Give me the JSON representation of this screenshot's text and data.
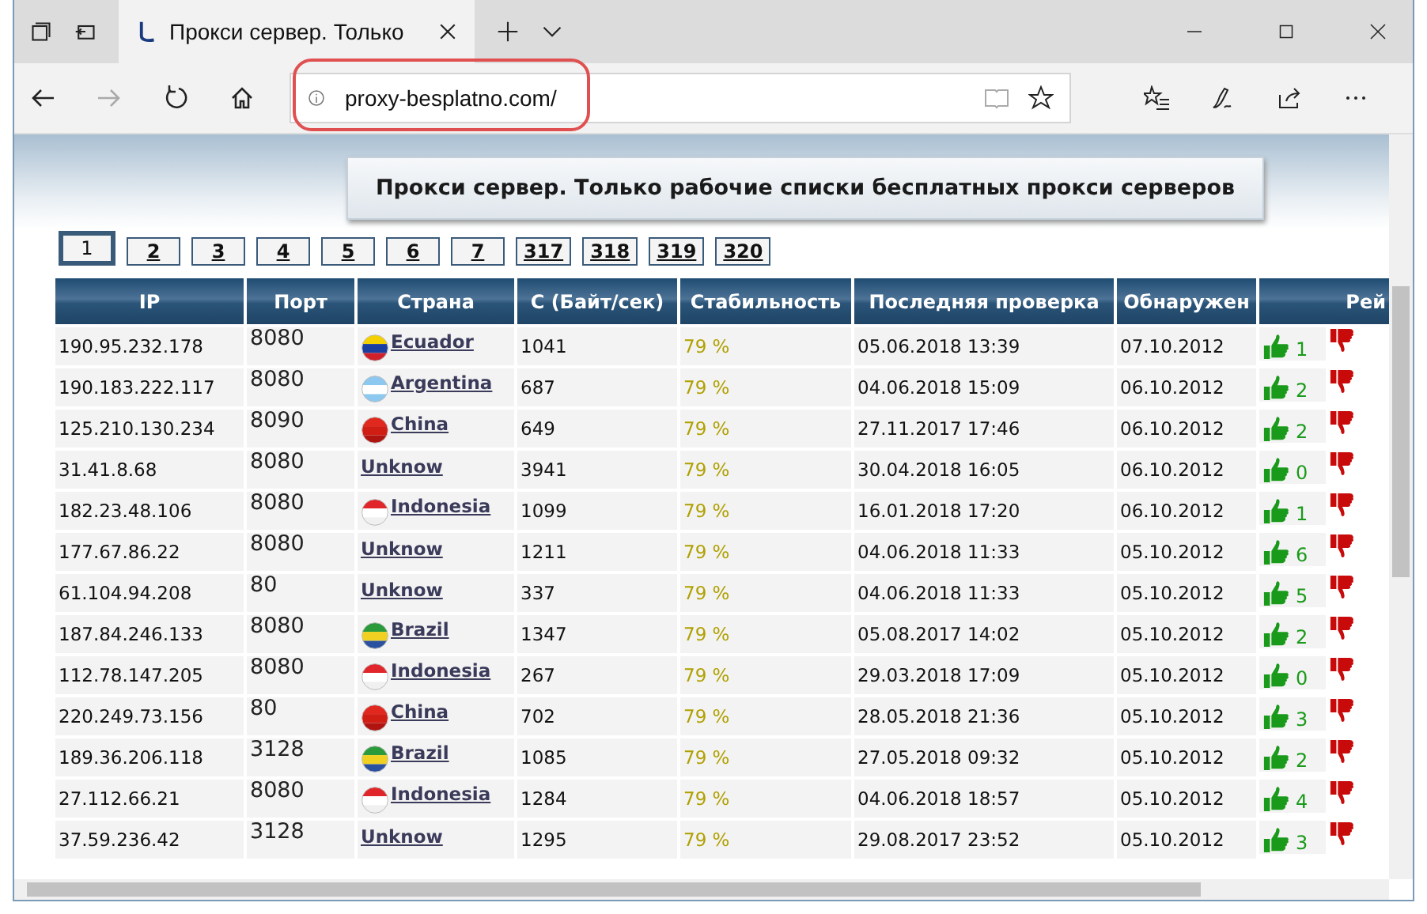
{
  "tab": {
    "title": "Прокси сервер. Только"
  },
  "address": {
    "url": "proxy-besplatno.com/"
  },
  "nav": {
    "forward_disabled": true
  },
  "banner": {
    "title": "Прокси сервер. Только рабочие списки бесплатных прокси серверов"
  },
  "pages": [
    {
      "label": "1",
      "selected": true
    },
    {
      "label": "2",
      "selected": false
    },
    {
      "label": "3",
      "selected": false
    },
    {
      "label": "4",
      "selected": false
    },
    {
      "label": "5",
      "selected": false
    },
    {
      "label": "6",
      "selected": false
    },
    {
      "label": "7",
      "selected": false
    },
    {
      "label": "317",
      "selected": false
    },
    {
      "label": "318",
      "selected": false
    },
    {
      "label": "319",
      "selected": false
    },
    {
      "label": "320",
      "selected": false
    }
  ],
  "columns": [
    "IP",
    "Порт",
    "Страна",
    "С (Байт/сек)",
    "Стабильность",
    "Последняя проверка",
    "Обнаружен",
    "Рей"
  ],
  "rows": [
    {
      "ip": "190.95.232.178",
      "port": "8080",
      "country": "Ecuador",
      "kind": "ecuador",
      "speed": "1041",
      "stability": "79 %",
      "checked": "05.06.2018 13:39",
      "found": "07.10.2012",
      "votes": "1"
    },
    {
      "ip": "190.183.222.117",
      "port": "8080",
      "country": "Argentina",
      "kind": "argentina",
      "speed": "687",
      "stability": "79 %",
      "checked": "04.06.2018 15:09",
      "found": "06.10.2012",
      "votes": "2"
    },
    {
      "ip": "125.210.130.234",
      "port": "8090",
      "country": "China",
      "kind": "china",
      "speed": "649",
      "stability": "79 %",
      "checked": "27.11.2017 17:46",
      "found": "06.10.2012",
      "votes": "2"
    },
    {
      "ip": "31.41.8.68",
      "port": "8080",
      "country": "Unknow",
      "kind": "none",
      "speed": "3941",
      "stability": "79 %",
      "checked": "30.04.2018 16:05",
      "found": "06.10.2012",
      "votes": "0"
    },
    {
      "ip": "182.23.48.106",
      "port": "8080",
      "country": "Indonesia",
      "kind": "indonesia",
      "speed": "1099",
      "stability": "79 %",
      "checked": "16.01.2018 17:20",
      "found": "06.10.2012",
      "votes": "1"
    },
    {
      "ip": "177.67.86.22",
      "port": "8080",
      "country": "Unknow",
      "kind": "none",
      "speed": "1211",
      "stability": "79 %",
      "checked": "04.06.2018 11:33",
      "found": "05.10.2012",
      "votes": "6"
    },
    {
      "ip": "61.104.94.208",
      "port": "80",
      "country": "Unknow",
      "kind": "none",
      "speed": "337",
      "stability": "79 %",
      "checked": "04.06.2018 11:33",
      "found": "05.10.2012",
      "votes": "5"
    },
    {
      "ip": "187.84.246.133",
      "port": "8080",
      "country": "Brazil",
      "kind": "brazil",
      "speed": "1347",
      "stability": "79 %",
      "checked": "05.08.2017 14:02",
      "found": "05.10.2012",
      "votes": "2"
    },
    {
      "ip": "112.78.147.205",
      "port": "8080",
      "country": "Indonesia",
      "kind": "indonesia",
      "speed": "267",
      "stability": "79 %",
      "checked": "29.03.2018 17:09",
      "found": "05.10.2012",
      "votes": "0"
    },
    {
      "ip": "220.249.73.156",
      "port": "80",
      "country": "China",
      "kind": "china",
      "speed": "702",
      "stability": "79 %",
      "checked": "28.05.2018 21:36",
      "found": "05.10.2012",
      "votes": "3"
    },
    {
      "ip": "189.36.206.118",
      "port": "3128",
      "country": "Brazil",
      "kind": "brazil",
      "speed": "1085",
      "stability": "79 %",
      "checked": "27.05.2018 09:32",
      "found": "05.10.2012",
      "votes": "2"
    },
    {
      "ip": "27.112.66.21",
      "port": "8080",
      "country": "Indonesia",
      "kind": "indonesia",
      "speed": "1284",
      "stability": "79 %",
      "checked": "04.06.2018 18:57",
      "found": "05.10.2012",
      "votes": "4"
    },
    {
      "ip": "37.59.236.42",
      "port": "3128",
      "country": "Unknow",
      "kind": "none",
      "speed": "1295",
      "stability": "79 %",
      "checked": "29.08.2017 23:52",
      "found": "05.10.2012",
      "votes": "3"
    }
  ]
}
